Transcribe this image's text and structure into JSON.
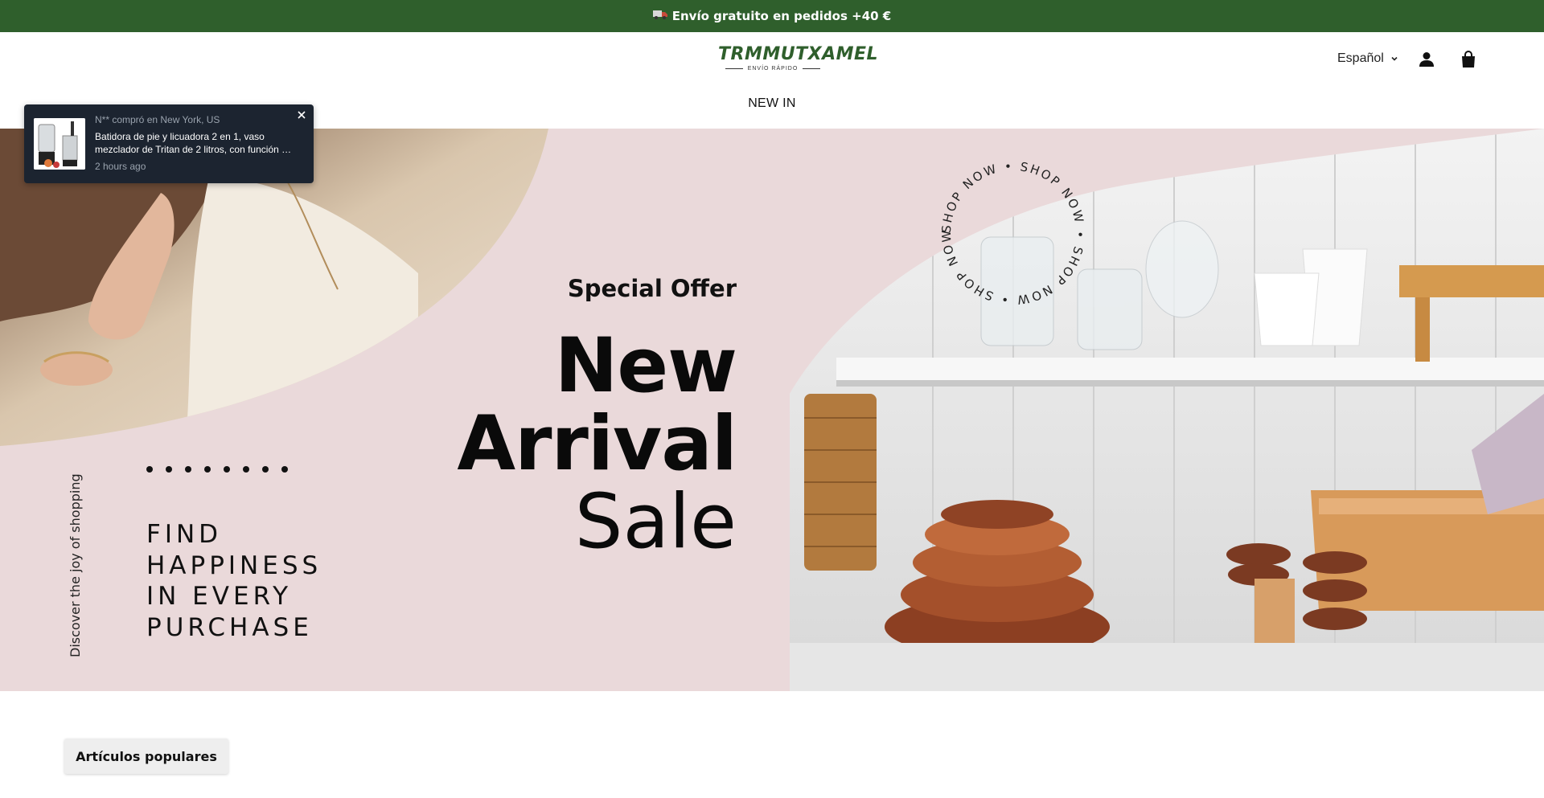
{
  "announcement": {
    "text": "Envío gratuito en pedidos +40 €",
    "icon": "truck-icon",
    "bg_color": "#2f5f2c"
  },
  "header": {
    "logo_main": "TRMMUTXAMEL",
    "logo_sub": "ENVÍO RÁPIDO",
    "language": "Español",
    "account_icon": "account-icon",
    "cart_icon": "bag-icon"
  },
  "nav": {
    "items": [
      {
        "label": "NEW IN"
      }
    ]
  },
  "hero": {
    "special_offer": "Special Offer",
    "line1": "New",
    "line2": "Arrival",
    "line3": "Sale",
    "find_lines": [
      "FIND",
      "HAPPINESS",
      "IN EVERY",
      "PURCHASE"
    ],
    "side_text": "Discover the joy of shopping",
    "circle_text": "SHOP NOW • SHOP NOW • SHOP NOW • SHOP NOW •",
    "bg_color": "#ead9da"
  },
  "popup": {
    "title": "N** compró en New York, US",
    "description": "Batidora de pie y licuadora 2 en 1, vaso mezclador de Tritan de 2 litros, con función …",
    "time": "2 hours ago"
  },
  "section": {
    "tab_label": "Artículos populares"
  }
}
